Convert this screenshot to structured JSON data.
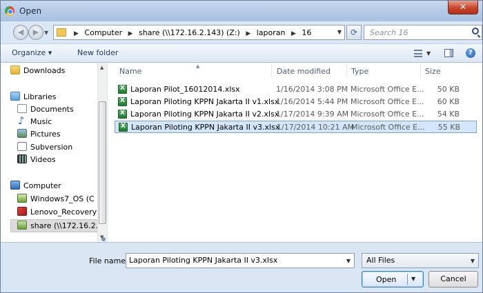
{
  "window": {
    "title": "Open",
    "close_label": "✕"
  },
  "address": {
    "crumbs": [
      "Computer",
      "share (\\\\172.16.2.143) (Z:)",
      "laporan",
      "16"
    ]
  },
  "search": {
    "placeholder": "Search 16"
  },
  "toolbar": {
    "organize_label": "Organize ▾",
    "new_folder_label": "New folder"
  },
  "sidebar": {
    "items": [
      {
        "label": "Downloads"
      },
      {
        "label": "Libraries"
      },
      {
        "label": "Documents"
      },
      {
        "label": "Music"
      },
      {
        "label": "Pictures"
      },
      {
        "label": "Subversion"
      },
      {
        "label": "Videos"
      },
      {
        "label": "Computer"
      },
      {
        "label": "Windows7_OS (C"
      },
      {
        "label": "Lenovo_Recovery"
      },
      {
        "label": "share (\\\\172.16.2."
      }
    ]
  },
  "columns": {
    "name": "Name",
    "date": "Date modified",
    "type": "Type",
    "size": "Size"
  },
  "files": [
    {
      "name": "Laporan Pilot_16012014.xlsx",
      "date": "1/16/2014 3:08 PM",
      "type": "Microsoft Office E...",
      "size": "50 KB"
    },
    {
      "name": "Laporan Piloting KPPN Jakarta II v1.xlsx",
      "date": "1/16/2014 5:44 PM",
      "type": "Microsoft Office E...",
      "size": "60 KB"
    },
    {
      "name": "Laporan Piloting KPPN Jakarta II v2.xlsx",
      "date": "1/17/2014 9:39 AM",
      "type": "Microsoft Office E...",
      "size": "54 KB"
    },
    {
      "name": "Laporan Piloting KPPN Jakarta II v3.xlsx",
      "date": "1/17/2014 10:21 AM",
      "type": "Microsoft Office E...",
      "size": "55 KB"
    }
  ],
  "selected_file_index": 3,
  "footer": {
    "file_name_label": "File name:",
    "file_name_value": "Laporan Piloting KPPN Jakarta II v3.xlsx",
    "filter_value": "All Files",
    "open_label": "Open",
    "cancel_label": "Cancel"
  }
}
